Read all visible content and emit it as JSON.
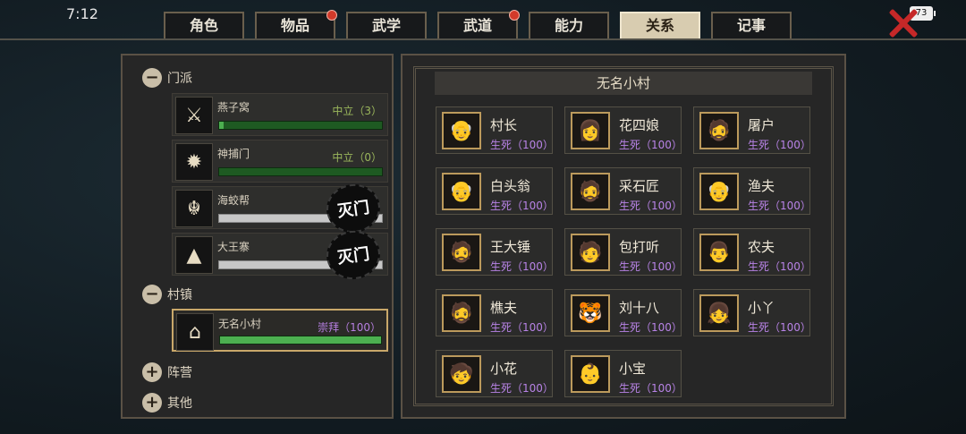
{
  "status_bar": {
    "time": "7:12",
    "battery": "73"
  },
  "tabs": [
    {
      "label": "角色",
      "active": false,
      "dot": false
    },
    {
      "label": "物品",
      "active": false,
      "dot": true
    },
    {
      "label": "武学",
      "active": false,
      "dot": false
    },
    {
      "label": "武道",
      "active": false,
      "dot": true
    },
    {
      "label": "能力",
      "active": false,
      "dot": false
    },
    {
      "label": "关系",
      "active": true,
      "dot": false
    },
    {
      "label": "记事",
      "active": false,
      "dot": false
    }
  ],
  "left": {
    "sections": {
      "sect": "门派",
      "town": "村镇",
      "camp": "阵营",
      "other": "其他"
    },
    "factions": [
      {
        "name": "燕子窝",
        "status": "中立（3）",
        "level": 0.03,
        "icon": "swords-emblem-icon"
      },
      {
        "name": "神捕门",
        "status": "中立（0）",
        "level": 0.0,
        "icon": "sun-emblem-icon"
      },
      {
        "name": "海蛟帮",
        "status": "",
        "level": 0.0,
        "stamp": "灭门",
        "icon": "dragon-emblem-icon"
      },
      {
        "name": "大王寨",
        "status": "",
        "level": 0.0,
        "stamp": "灭门",
        "icon": "mountain-emblem-icon"
      }
    ],
    "town": {
      "name": "无名小村",
      "status": "崇拜（100）",
      "level": 1.0,
      "icon": "house-emblem-icon"
    }
  },
  "right": {
    "title": "无名小村",
    "npcs": [
      {
        "name": "村长",
        "rel": "生死（100）"
      },
      {
        "name": "花四娘",
        "rel": "生死（100）"
      },
      {
        "name": "屠户",
        "rel": "生死（100）"
      },
      {
        "name": "白头翁",
        "rel": "生死（100）"
      },
      {
        "name": "采石匠",
        "rel": "生死（100）"
      },
      {
        "name": "渔夫",
        "rel": "生死（100）"
      },
      {
        "name": "王大锤",
        "rel": "生死（100）"
      },
      {
        "name": "包打听",
        "rel": "生死（100）"
      },
      {
        "name": "农夫",
        "rel": "生死（100）"
      },
      {
        "name": "樵夫",
        "rel": "生死（100）"
      },
      {
        "name": "刘十八",
        "rel": "生死（100）"
      },
      {
        "name": "小丫",
        "rel": "生死（100）"
      },
      {
        "name": "小花",
        "rel": "生死（100）"
      },
      {
        "name": "小宝",
        "rel": "生死（100）"
      }
    ]
  }
}
